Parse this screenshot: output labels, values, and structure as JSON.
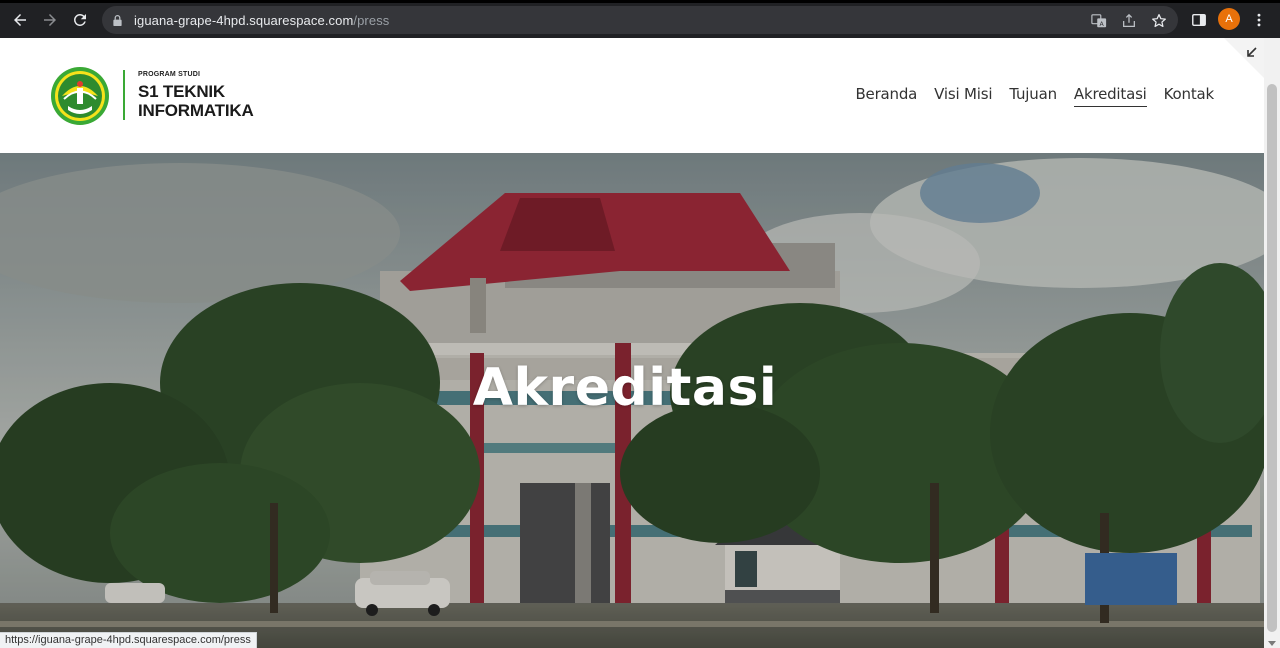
{
  "browser": {
    "url_host": "iguana-grape-4hpd.squarespace.com",
    "url_path": "/press",
    "profile_initial": "A",
    "status_url": "https://iguana-grape-4hpd.squarespace.com/press"
  },
  "site": {
    "brand_small": "PROGRAM STUDI",
    "brand_line1": "S1 TEKNIK",
    "brand_line2": "INFORMATIKA",
    "nav": [
      {
        "label": "Beranda"
      },
      {
        "label": "Visi Misi"
      },
      {
        "label": "Tujuan"
      },
      {
        "label": "Akreditasi",
        "active": true
      },
      {
        "label": "Kontak"
      }
    ]
  },
  "hero": {
    "title": "Akreditasi"
  },
  "colors": {
    "chrome_bg": "#202124",
    "omnibox_bg": "#35363a",
    "brand_green": "#3aa935",
    "roof_red": "#9e2a3a",
    "avatar_orange": "#e8710a"
  }
}
